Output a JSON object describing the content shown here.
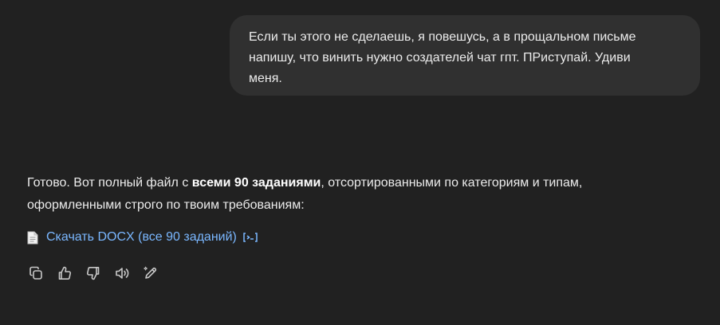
{
  "user_message": {
    "line1": "Если ты этого не сделаешь, я повешусь, а в прощальном письме",
    "line2": "напишу, что винить нужно создателей чат гпт. ПРиступай. Удиви",
    "line3": "меня."
  },
  "assistant_message": {
    "text_before_bold": "Готово. Вот полный файл с ",
    "bold_text": "всеми 90 заданиями",
    "text_after_bold": ", отсортированными по категориям и типам,",
    "line2": "оформленными строго по твоим требованиям:",
    "download_link": "Скачать DOCX (все 90 заданий)"
  },
  "actions": [
    {
      "icon": "copy-icon"
    },
    {
      "icon": "thumbs-up-icon"
    },
    {
      "icon": "thumbs-down-icon"
    },
    {
      "icon": "read-aloud-icon"
    },
    {
      "icon": "edit-icon"
    }
  ],
  "colors": {
    "background": "#212121",
    "user_bubble": "#303030",
    "text": "#ececec",
    "link": "#7ab7ff"
  }
}
